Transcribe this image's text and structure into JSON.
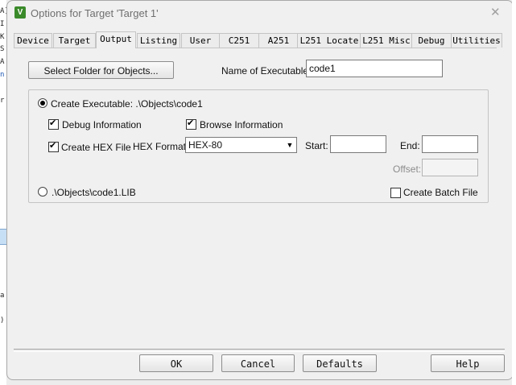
{
  "window": {
    "title": "Options for Target 'Target 1'",
    "icon_name": "uvision-app-icon",
    "close_glyph": "✕"
  },
  "background_code": [
    "A]",
    "I",
    "K",
    "S",
    "A",
    "n",
    "r",
    "a",
    ")"
  ],
  "tabs": [
    {
      "label": "Device",
      "active": false
    },
    {
      "label": "Target",
      "active": false
    },
    {
      "label": "Output",
      "active": true
    },
    {
      "label": "Listing",
      "active": false
    },
    {
      "label": "User",
      "active": false
    },
    {
      "label": "C251",
      "active": false
    },
    {
      "label": "A251",
      "active": false
    },
    {
      "label": "L251 Locate",
      "active": false
    },
    {
      "label": "L251 Misc",
      "active": false
    },
    {
      "label": "Debug",
      "active": false
    },
    {
      "label": "Utilities",
      "active": false
    }
  ],
  "output": {
    "select_folder_label": "Select Folder for Objects...",
    "name_exec_label": "Name of Executable:",
    "name_exec_value": "code1",
    "create_exec_label": "Create Executable:  .\\Objects\\code1",
    "create_exec_selected": true,
    "debug_info_label": "Debug Information",
    "debug_info_checked": true,
    "browse_info_label": "Browse Information",
    "browse_info_checked": true,
    "create_hex_label": "Create HEX File",
    "create_hex_checked": true,
    "hex_format_label": "HEX Format:",
    "hex_format_value": "HEX-80",
    "start_label": "Start:",
    "start_value": "",
    "end_label": "End:",
    "end_value": "",
    "offset_label": "Offset:",
    "offset_value": "",
    "lib_label": ".\\Objects\\code1.LIB",
    "lib_selected": false,
    "batch_label": "Create Batch File",
    "batch_checked": false
  },
  "footer": {
    "ok": "OK",
    "cancel": "Cancel",
    "defaults": "Defaults",
    "help": "Help"
  },
  "checkmark": "✔"
}
